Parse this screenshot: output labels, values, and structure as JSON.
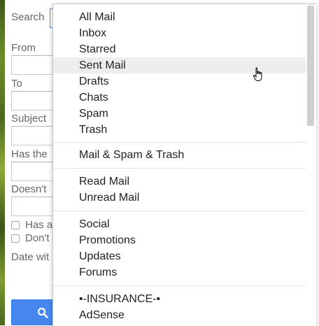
{
  "background_form": {
    "search_label": "Search",
    "fields": [
      {
        "label": "From"
      },
      {
        "label": "To"
      },
      {
        "label": "Subject"
      },
      {
        "label": "Has the"
      },
      {
        "label": "Doesn't"
      }
    ],
    "checkboxes": [
      "Has a",
      "Don't"
    ],
    "date_label": "Date wit",
    "search_button_icon": "search-icon"
  },
  "dropdown": {
    "groups": [
      {
        "items": [
          "All Mail",
          "Inbox",
          "Starred",
          "Sent Mail",
          "Drafts",
          "Chats",
          "Spam",
          "Trash"
        ]
      },
      {
        "items": [
          "Mail & Spam & Trash"
        ]
      },
      {
        "items": [
          "Read Mail",
          "Unread Mail"
        ]
      },
      {
        "items": [
          "Social",
          "Promotions",
          "Updates",
          "Forums"
        ]
      },
      {
        "items": [
          "•-INSURANCE-•",
          "AdSense"
        ]
      }
    ],
    "hovered_item": "Sent Mail"
  },
  "colors": {
    "accent_blue": "#4787ed",
    "hover_bg": "#eeeeee",
    "label_gray": "#666666"
  }
}
